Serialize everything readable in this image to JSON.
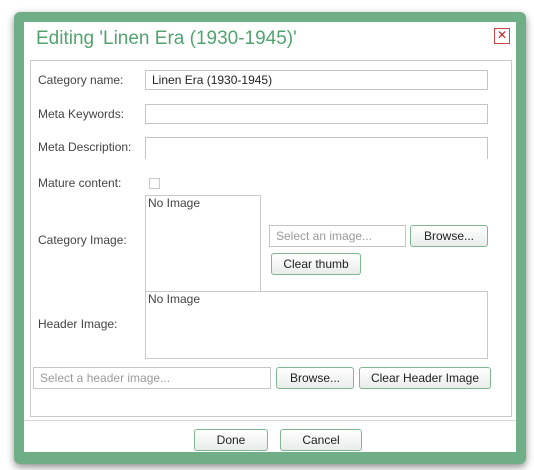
{
  "dialog": {
    "title": "Editing 'Linen Era (1930-1945)'",
    "close_glyph": "✕"
  },
  "form": {
    "category_name_label": "Category name:",
    "category_name_value": "Linen Era (1930-1945)",
    "meta_keywords_label": "Meta Keywords:",
    "meta_keywords_value": "",
    "meta_description_label": "Meta Description:",
    "meta_description_value": "",
    "mature_content_label": "Mature content:",
    "mature_content_checked": false,
    "category_image_label": "Category Image:",
    "category_image_preview": "No Image",
    "category_image_placeholder": "Select an image...",
    "browse_label": "Browse...",
    "clear_thumb_label": "Clear thumb",
    "header_image_label": "Header Image:",
    "header_image_preview": "No Image",
    "header_image_placeholder": "Select a header image...",
    "header_browse_label": "Browse...",
    "clear_header_label": "Clear Header Image"
  },
  "footer": {
    "done_label": "Done",
    "cancel_label": "Cancel"
  },
  "colors": {
    "frame": "#6fae86",
    "title": "#52a36f",
    "button_border": "#7fb890"
  }
}
